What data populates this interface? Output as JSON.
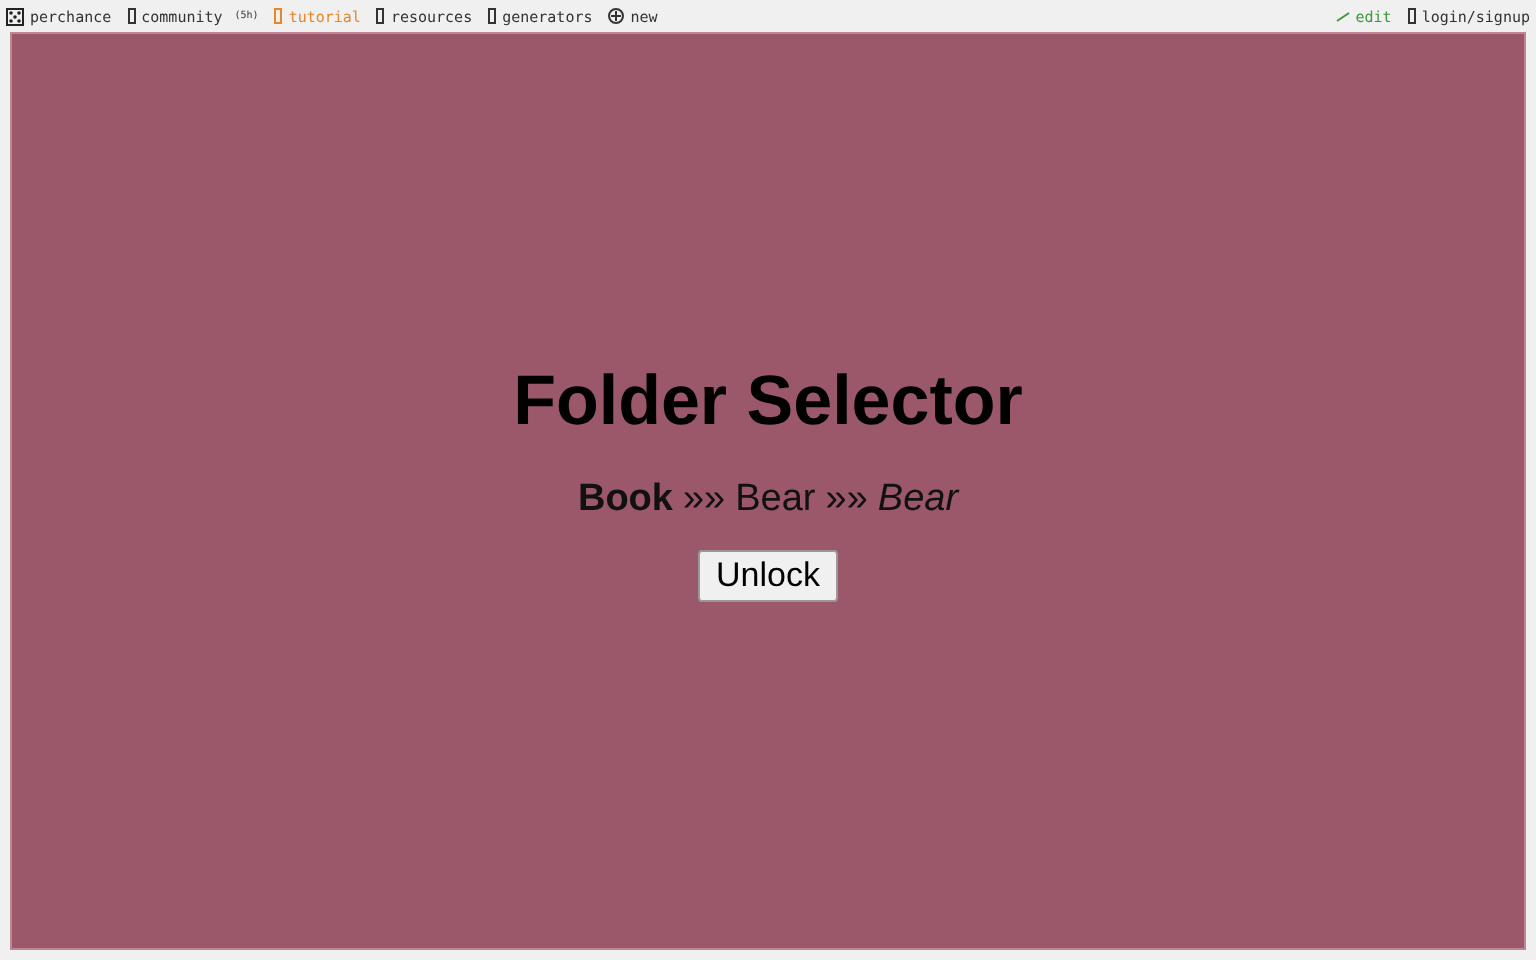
{
  "top_bar": {
    "left": [
      {
        "label": "perchance",
        "kind": "dice",
        "color": "#333333"
      },
      {
        "label": "community",
        "badge": "(5h)",
        "kind": "box",
        "color": "#333333"
      },
      {
        "label": "tutorial",
        "kind": "box",
        "color": "#e8862a"
      },
      {
        "label": "resources",
        "kind": "box",
        "color": "#333333"
      },
      {
        "label": "generators",
        "kind": "box",
        "color": "#333333"
      },
      {
        "label": "new",
        "kind": "plus",
        "color": "#333333"
      }
    ],
    "right": [
      {
        "label": "edit",
        "kind": "pencil",
        "color": "#3a9a3a"
      },
      {
        "label": "login/signup",
        "kind": "box",
        "color": "#333333"
      }
    ]
  },
  "title": "Folder Selector",
  "path": [
    {
      "text": "Book",
      "kind": "bold"
    },
    {
      "text": "»»",
      "kind": "separator"
    },
    {
      "text": "Bear",
      "kind": "plain"
    },
    {
      "text": "»»",
      "kind": "separator"
    },
    {
      "text": "Bear",
      "kind": "italic"
    }
  ],
  "button": "Unlock"
}
